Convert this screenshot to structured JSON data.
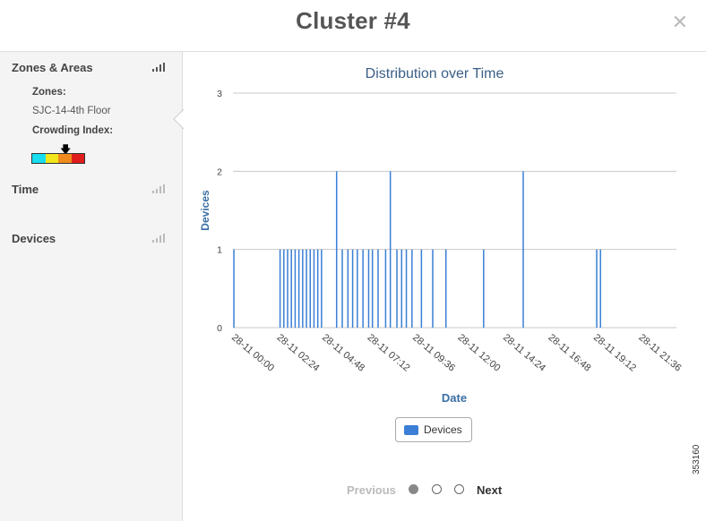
{
  "header": {
    "title": "Cluster #4",
    "close_icon": "close-icon"
  },
  "sidebar": {
    "sections": [
      {
        "key": "zones",
        "label": "Zones & Areas"
      },
      {
        "key": "time",
        "label": "Time"
      },
      {
        "key": "devices",
        "label": "Devices"
      }
    ],
    "zones_label": "Zones:",
    "zone_value": "SJC-14-4th Floor",
    "crowding_label": "Crowding Index:",
    "crowding_colors": [
      "#18dcef",
      "#f2e51a",
      "#f08a1c",
      "#e01d1d"
    ],
    "crowding_marker": "down-arrow-icon"
  },
  "chart_data": {
    "type": "bar",
    "title": "Distribution over Time",
    "xlabel": "Date",
    "ylabel": "Devices",
    "ylim": [
      0,
      3
    ],
    "yticks": [
      "0",
      "1",
      "2",
      "3"
    ],
    "x_tick_labels": [
      "28-11 00:00",
      "28-11 02:24",
      "28-11 04:48",
      "28-11 07:12",
      "28-11 09:36",
      "28-11 12:00",
      "28-11 14:24",
      "28-11 16:48",
      "28-11 19:12",
      "28-11 21:36"
    ],
    "x_unit": "hours since 28-11 00:00",
    "x_range": [
      0,
      24
    ],
    "series": [
      {
        "name": "Devices",
        "color": "#3a7fd5",
        "points": [
          {
            "x": 0.05,
            "y": 1
          },
          {
            "x": 2.5,
            "y": 1
          },
          {
            "x": 2.7,
            "y": 1
          },
          {
            "x": 2.9,
            "y": 1
          },
          {
            "x": 3.1,
            "y": 1
          },
          {
            "x": 3.3,
            "y": 1
          },
          {
            "x": 3.5,
            "y": 1
          },
          {
            "x": 3.7,
            "y": 1
          },
          {
            "x": 3.9,
            "y": 1
          },
          {
            "x": 4.1,
            "y": 1
          },
          {
            "x": 4.3,
            "y": 1
          },
          {
            "x": 4.5,
            "y": 1
          },
          {
            "x": 4.7,
            "y": 1
          },
          {
            "x": 5.5,
            "y": 2
          },
          {
            "x": 5.8,
            "y": 1
          },
          {
            "x": 6.1,
            "y": 1
          },
          {
            "x": 6.35,
            "y": 1
          },
          {
            "x": 6.6,
            "y": 1
          },
          {
            "x": 6.9,
            "y": 1
          },
          {
            "x": 7.2,
            "y": 1
          },
          {
            "x": 7.4,
            "y": 1
          },
          {
            "x": 7.7,
            "y": 1
          },
          {
            "x": 8.1,
            "y": 1
          },
          {
            "x": 8.35,
            "y": 2
          },
          {
            "x": 8.7,
            "y": 1
          },
          {
            "x": 8.95,
            "y": 1
          },
          {
            "x": 9.2,
            "y": 1
          },
          {
            "x": 9.5,
            "y": 1
          },
          {
            "x": 10.0,
            "y": 1
          },
          {
            "x": 10.6,
            "y": 1
          },
          {
            "x": 11.3,
            "y": 1
          },
          {
            "x": 13.3,
            "y": 1
          },
          {
            "x": 15.4,
            "y": 2
          },
          {
            "x": 19.3,
            "y": 1
          },
          {
            "x": 19.5,
            "y": 1
          }
        ]
      }
    ],
    "legend": {
      "position": "bottom-center",
      "items": [
        "Devices"
      ]
    },
    "grid": true
  },
  "pager": {
    "previous_label": "Previous",
    "next_label": "Next",
    "pages": 3,
    "current_page": 1
  },
  "figure_id": "353160"
}
